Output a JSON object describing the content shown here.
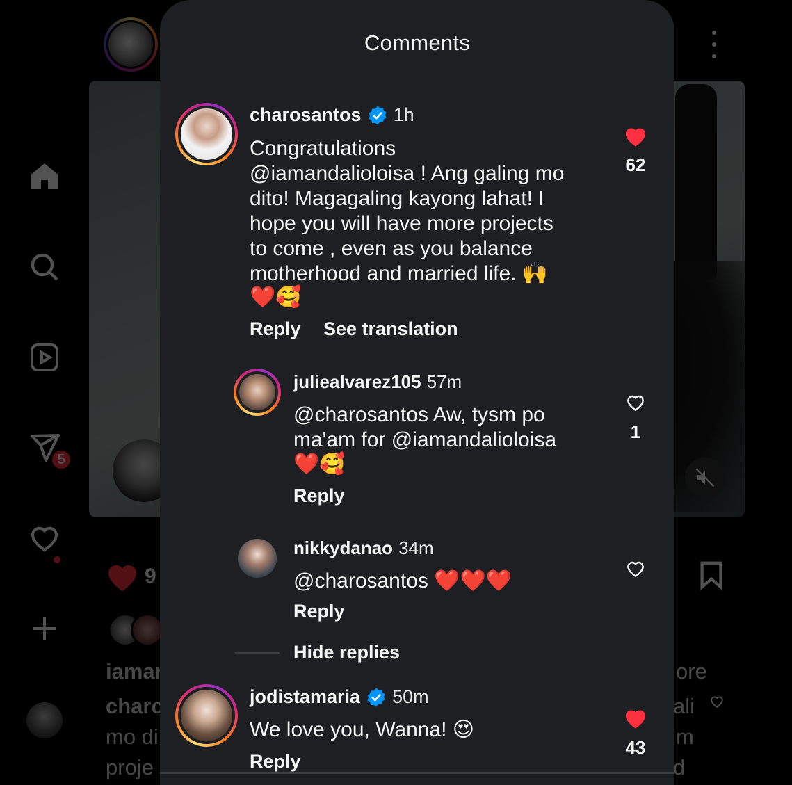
{
  "background": {
    "nav": [
      {
        "name": "home-icon"
      },
      {
        "name": "search-icon"
      },
      {
        "name": "reels-icon"
      },
      {
        "name": "direct-messages-icon"
      },
      {
        "name": "notifications-heart-icon"
      },
      {
        "name": "create-plus-icon"
      }
    ],
    "messages_badge": "5",
    "like_count_partial": "9",
    "caption_user_partial": "iamar",
    "caption_line2": "charc",
    "caption_line3": "mo di",
    "caption_line4": "proje",
    "right_text_1": "ore",
    "right_text_2": "ali",
    "right_text_3": "m",
    "right_text_4": "d"
  },
  "modal": {
    "title": "Comments",
    "comments": [
      {
        "username": "charosantos",
        "verified": true,
        "time": "1h",
        "text": "Congratulations\n@iamandalioloisa ! Ang galing mo\ndito! Magagaling kayong lahat! I\nhope you will have more projects\nto come , even as you balance\nmotherhood and married life. 🙌",
        "emojis": "❤️🥰",
        "liked": true,
        "like_count": "62",
        "reply_label": "Reply",
        "translate_label": "See translation"
      },
      {
        "username": "juliealvarez105",
        "verified": false,
        "time": "57m",
        "text": "@charosantos Aw, tysm po\nma'am for @iamandalioloisa",
        "emojis": "❤️🥰",
        "liked": false,
        "like_count": "1",
        "reply_label": "Reply"
      },
      {
        "username": "nikkydanao",
        "verified": false,
        "time": "34m",
        "text": "@charosantos ❤️❤️❤️",
        "liked": false,
        "like_count": "",
        "reply_label": "Reply"
      },
      {
        "username": "jodistamaria",
        "verified": true,
        "time": "50m",
        "text": "We love you, Wanna! 😍",
        "liked": true,
        "like_count": "43",
        "reply_label": "Reply"
      }
    ],
    "hide_replies_label": "Hide replies"
  },
  "colors": {
    "modal_bg": "#1d1f22",
    "like_red": "#ff3040",
    "verified_blue": "#0095f6",
    "text": "#f5f5f5"
  }
}
